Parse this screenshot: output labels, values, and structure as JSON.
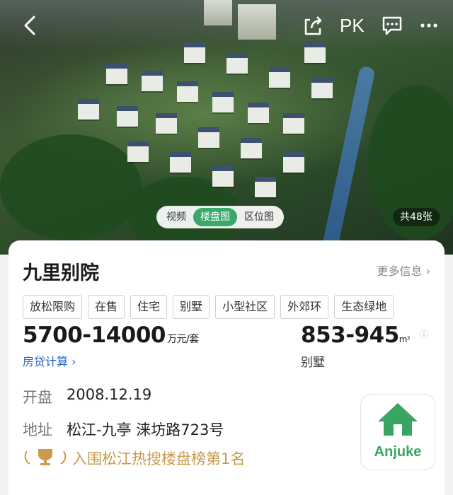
{
  "header": {
    "pk_label": "PK",
    "back_icon": "back-arrow-icon",
    "share_icon": "share-icon",
    "chat_icon": "chat-icon",
    "more_icon": "more-icon"
  },
  "media": {
    "tabs": [
      "视频",
      "楼盘图",
      "区位图"
    ],
    "active_tab": "楼盘图",
    "photo_count": "共48张"
  },
  "project": {
    "name": "九里别院",
    "more_info": "更多信息 ›",
    "tags": [
      "放松限购",
      "在售",
      "住宅",
      "别墅",
      "小型社区",
      "外郊环",
      "生态绿地"
    ],
    "price": "5700-14000",
    "price_unit": "万元/套",
    "loan_link": "房贷计算 ›",
    "area": "853-945",
    "area_unit": "m²",
    "area_type": "别墅",
    "opening_label": "开盘",
    "opening_date": "2008.12.19",
    "address_label": "地址",
    "address": "松江-九亭 涞坊路723号",
    "ranking": "入围松江热搜楼盘榜第1名"
  },
  "logo": {
    "text": "Anjuke",
    "color": "#3aa463"
  },
  "colors": {
    "accent_green": "#39a86b",
    "link_blue": "#2a64c8",
    "gold": "#c89a4a"
  }
}
